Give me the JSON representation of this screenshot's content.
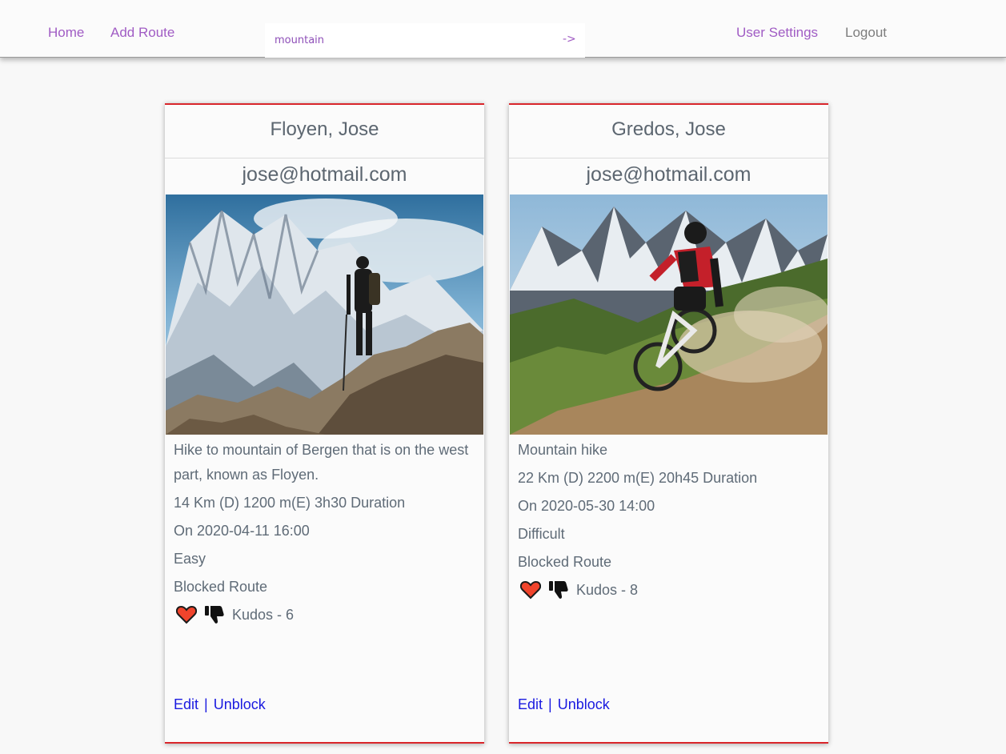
{
  "nav": {
    "home": "Home",
    "add_route": "Add Route",
    "search_value": "mountain",
    "search_go": "->",
    "user_settings": "User Settings",
    "logout": "Logout"
  },
  "cards": [
    {
      "title": "Floyen, Jose",
      "email": "jose@hotmail.com",
      "image_icon": "hiker-mountain-photo",
      "description": "Hike to mountain of Bergen that is on the west part, known as Floyen.",
      "stats": "14 Km (D) 1200 m(E) 3h30 Duration",
      "date": "On 2020-04-11 16:00",
      "difficulty": "Easy",
      "status": "Blocked Route",
      "kudos": "Kudos - 6",
      "edit": "Edit",
      "separator": "|",
      "unblock": "Unblock"
    },
    {
      "title": "Gredos, Jose",
      "email": "jose@hotmail.com",
      "image_icon": "mountain-biker-photo",
      "description": "Mountain hike",
      "stats": "22 Km (D) 2200 m(E) 20h45 Duration",
      "date": "On 2020-05-30 14:00",
      "difficulty": "Difficult",
      "status": "Blocked Route",
      "kudos": "Kudos - 8",
      "edit": "Edit",
      "separator": "|",
      "unblock": "Unblock"
    }
  ],
  "colors": {
    "accent": "#a05cc4",
    "card_border": "#d9262b",
    "link": "#1a1ae0",
    "heart": "#f0442c"
  }
}
